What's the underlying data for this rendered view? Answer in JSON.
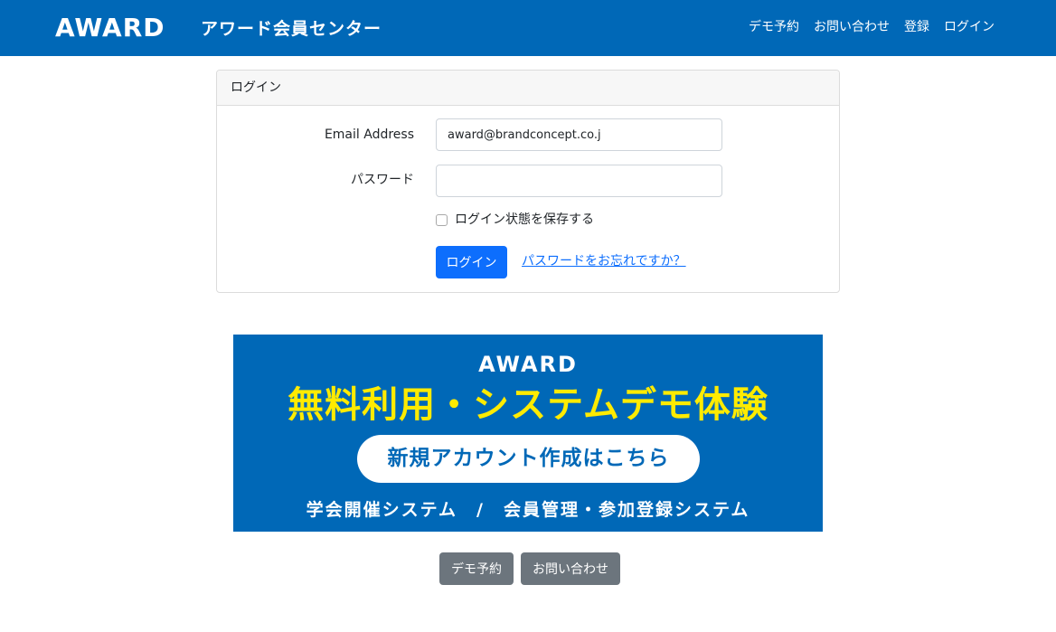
{
  "header": {
    "logo": "AWARD",
    "title": "アワード会員センター",
    "nav": [
      "デモ予約",
      "お問い合わせ",
      "登録",
      "ログイン"
    ]
  },
  "login_card": {
    "header": "ログイン",
    "email_label": "Email Address",
    "email_value": "award@brandconcept.co.j",
    "password_label": "パスワード",
    "password_value": "",
    "remember_label": "ログイン状態を保存する",
    "remember_checked": false,
    "submit_label": "ログイン",
    "forgot_link": "パスワードをお忘れですか？"
  },
  "banner": {
    "logo": "AWARD",
    "headline": "無料利用・システムデモ体験",
    "cta": "新規アカウント作成はこちら",
    "subtitle": "学会開催システム　/　会員管理・参加登録システム",
    "colors": {
      "background": "#0068b7",
      "headline": "#ffeb00",
      "cta_text": "#0068b7"
    }
  },
  "footer": {
    "buttons": [
      "デモ予約",
      "お問い合わせ"
    ]
  },
  "colors": {
    "navbar": "#0068b7",
    "primary_button": "#0d6efd",
    "secondary_button": "#6c757d",
    "link": "#0d6efd"
  }
}
